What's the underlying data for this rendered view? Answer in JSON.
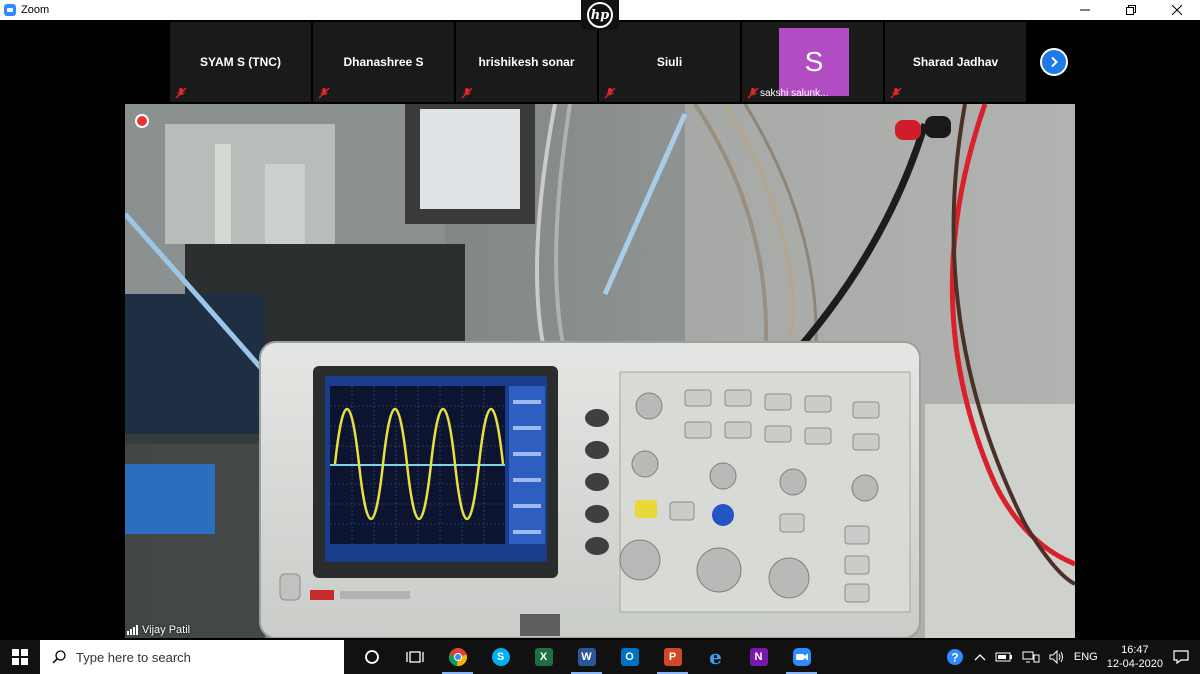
{
  "window": {
    "title": "Zoom"
  },
  "overlay": {
    "badge": "hp"
  },
  "participants": [
    {
      "name": "SYAM S (TNC)",
      "muted": true
    },
    {
      "name": "Dhanashree S",
      "muted": true
    },
    {
      "name": "hrishikesh sonar",
      "muted": true
    },
    {
      "name": "Siuli",
      "muted": true
    },
    {
      "name": "sakshi salunk...",
      "avatar_letter": "S",
      "muted": true
    },
    {
      "name": "Sharad Jadhav",
      "muted": true
    }
  ],
  "active_speaker": {
    "name": "Vijay Patil"
  },
  "taskbar": {
    "search_placeholder": "Type here to search",
    "apps": [
      {
        "name": "Task View",
        "icon": "task-view-icon"
      },
      {
        "name": "Chrome",
        "icon": "chrome-icon"
      },
      {
        "name": "Skype",
        "icon": "skype-icon",
        "glyph": "S"
      },
      {
        "name": "Excel",
        "icon": "excel-icon",
        "glyph": "X"
      },
      {
        "name": "Word",
        "icon": "word-icon",
        "glyph": "W"
      },
      {
        "name": "Outlook",
        "icon": "outlook-icon",
        "glyph": "O"
      },
      {
        "name": "PowerPoint",
        "icon": "powerpoint-icon",
        "glyph": "P"
      },
      {
        "name": "Edge",
        "icon": "edge-icon",
        "glyph": "e"
      },
      {
        "name": "OneNote",
        "icon": "onenote-icon",
        "glyph": "N"
      },
      {
        "name": "Zoom",
        "icon": "zoom-icon"
      }
    ],
    "language": "ENG",
    "time": "16:47",
    "date": "12-04-2020"
  },
  "colors": {
    "zoom_blue": "#2d8cff",
    "avatar_purple": "#b14cc2",
    "mute_red": "#e02828",
    "scope_trace": "#e8e040",
    "scope_screen": "#1a3c8c"
  }
}
